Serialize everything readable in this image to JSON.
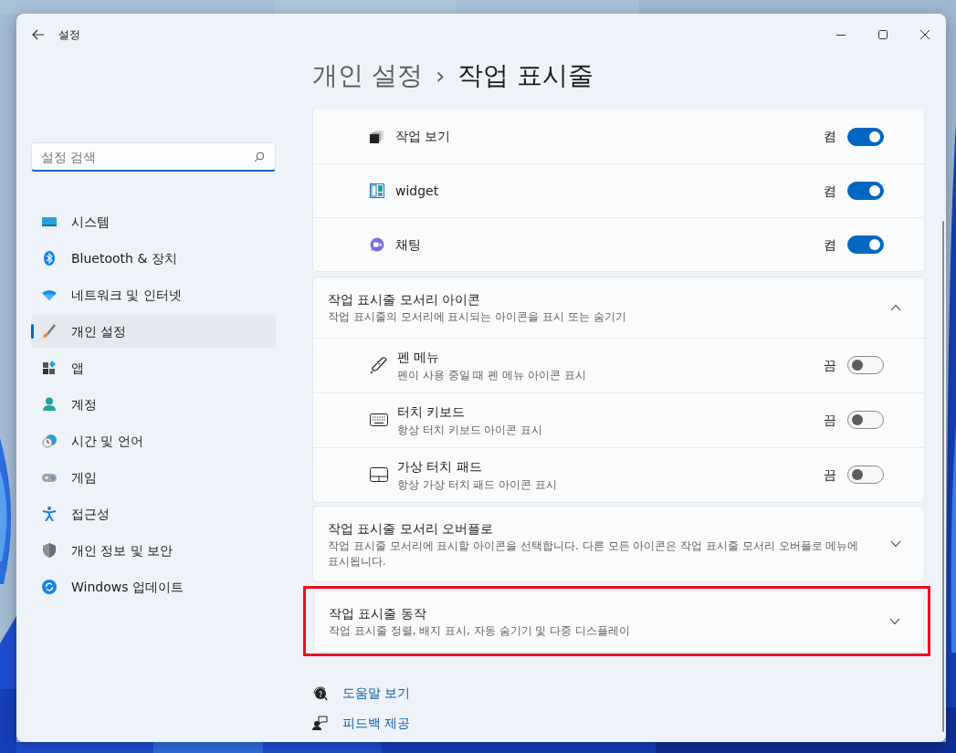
{
  "window": {
    "title": "설정"
  },
  "search": {
    "placeholder": "설정 검색"
  },
  "sidebar": {
    "items": [
      {
        "label": "시스템",
        "selected": false
      },
      {
        "label": "Bluetooth & 장치",
        "selected": false
      },
      {
        "label": "네트워크 및 인터넷",
        "selected": false
      },
      {
        "label": "개인 설정",
        "selected": true
      },
      {
        "label": "앱",
        "selected": false
      },
      {
        "label": "계정",
        "selected": false
      },
      {
        "label": "시간 및 언어",
        "selected": false
      },
      {
        "label": "게임",
        "selected": false
      },
      {
        "label": "접근성",
        "selected": false
      },
      {
        "label": "개인 정보 및 보안",
        "selected": false
      },
      {
        "label": "Windows 업데이트",
        "selected": false
      }
    ]
  },
  "breadcrumb": {
    "parent": "개인 설정",
    "separator": "›",
    "current": "작업 표시줄"
  },
  "sections": [
    {
      "kind": "list",
      "rows": [
        {
          "label": "작업 보기",
          "state_text": "켬",
          "on": true
        },
        {
          "label": "widget",
          "state_text": "켬",
          "on": true
        },
        {
          "label": "채팅",
          "state_text": "켬",
          "on": true
        }
      ]
    },
    {
      "kind": "expander",
      "title": "작업 표시줄 모서리 아이콘",
      "subtitle": "작업 표시줄의 모서리에 표시되는 아이콘을 표시 또는 숨기기",
      "expanded": true,
      "highlighted": false,
      "rows": [
        {
          "label": "펜 메뉴",
          "description": "펜이 사용 중일 때 펜 메뉴 아이콘 표시",
          "state_text": "끔",
          "on": false
        },
        {
          "label": "터치 키보드",
          "description": "항상 터치 키보드 아이콘 표시",
          "state_text": "끔",
          "on": false
        },
        {
          "label": "가상 터치 패드",
          "description": "항상 가상 터치 패드 아이콘 표시",
          "state_text": "끔",
          "on": false
        }
      ]
    },
    {
      "kind": "expander",
      "title": "작업 표시줄 모서리 오버플로",
      "subtitle": "작업 표시줄 모서리에 표시할 아이콘을 선택합니다. 다른 모든 아이콘은 작업 표시줄 모서리 오버플로 메뉴에 표시됩니다.",
      "expanded": false,
      "highlighted": false
    },
    {
      "kind": "expander",
      "title": "작업 표시줄 동작",
      "subtitle": "작업 표시줄 정렬, 배지 표시, 자동 숨기기 및 다중 디스플레이",
      "expanded": false,
      "highlighted": true
    }
  ],
  "links": [
    {
      "label": "도움말 보기"
    },
    {
      "label": "피드백 제공"
    }
  ]
}
